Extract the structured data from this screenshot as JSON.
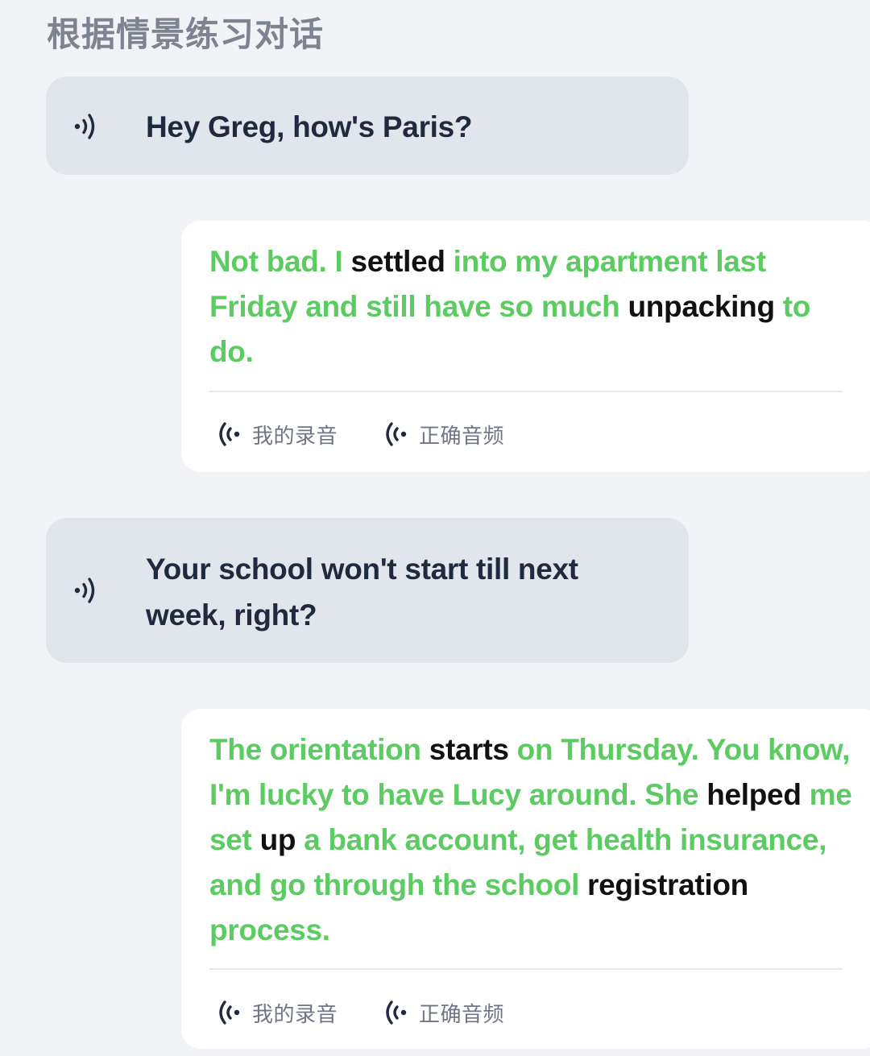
{
  "page": {
    "title": "根据情景练习对话"
  },
  "dialogue": [
    {
      "prompt": "Hey Greg, how's Paris?",
      "speaker_icon": "speaker-icon",
      "answer_segments": [
        {
          "text": "Not bad. I ",
          "status": "ok"
        },
        {
          "text": "settled",
          "status": "miss"
        },
        {
          "text": " into my apartment last Friday and still have so much ",
          "status": "ok"
        },
        {
          "text": "unpacking",
          "status": "miss"
        },
        {
          "text": " to do.",
          "status": "ok"
        }
      ],
      "my_recording_label": "我的录音",
      "correct_audio_label": "正确音频"
    },
    {
      "prompt": "Your school won't start till next week, right?",
      "speaker_icon": "speaker-icon",
      "answer_segments": [
        {
          "text": "The orientation ",
          "status": "ok"
        },
        {
          "text": "starts",
          "status": "miss"
        },
        {
          "text": " on Thursday. You know, I'm lucky to have Lucy around. She ",
          "status": "ok"
        },
        {
          "text": "helped",
          "status": "miss"
        },
        {
          "text": " me set ",
          "status": "ok"
        },
        {
          "text": "up",
          "status": "miss"
        },
        {
          "text": " a bank account, get health insurance, and go through the school ",
          "status": "ok"
        },
        {
          "text": "registration",
          "status": "miss"
        },
        {
          "text": " process.",
          "status": "ok"
        }
      ],
      "my_recording_label": "我的录音",
      "correct_audio_label": "正确音频"
    }
  ],
  "colors": {
    "correct_word": "#5ccb62",
    "incorrect_word": "#111111",
    "prompt_bubble_bg": "#e1e5ec",
    "page_bg": "#f2f3f6"
  }
}
